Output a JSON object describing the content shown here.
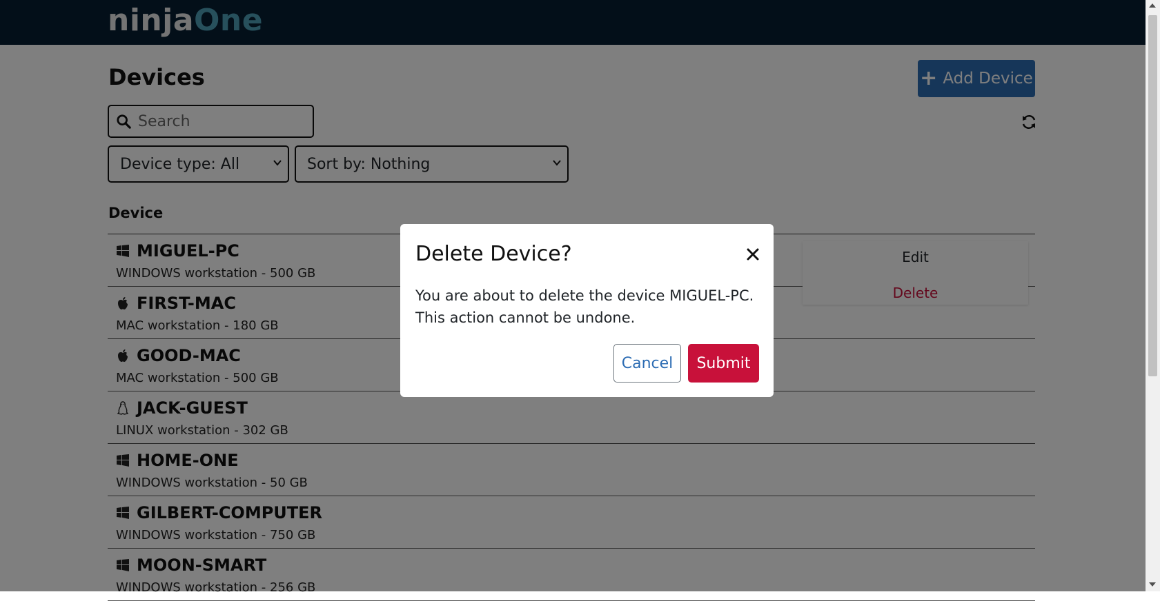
{
  "brand": {
    "logo_part1": "ninja",
    "logo_part2": "One"
  },
  "header": {
    "title": "Devices",
    "add_button_label": "Add Device"
  },
  "search": {
    "placeholder": "Search"
  },
  "filters": {
    "device_type": "Device type: All",
    "sort_by": "Sort by: Nothing"
  },
  "table": {
    "column_header": "Device"
  },
  "devices": [
    {
      "name": "MIGUEL-PC",
      "detail": "WINDOWS workstation - 500 GB",
      "os": "windows-icon"
    },
    {
      "name": "FIRST-MAC",
      "detail": "MAC workstation - 180 GB",
      "os": "apple-icon"
    },
    {
      "name": "GOOD-MAC",
      "detail": "MAC workstation - 500 GB",
      "os": "apple-icon"
    },
    {
      "name": "JACK-GUEST",
      "detail": "LINUX workstation - 302 GB",
      "os": "linux-icon"
    },
    {
      "name": "HOME-ONE",
      "detail": "WINDOWS workstation - 50 GB",
      "os": "windows-icon"
    },
    {
      "name": "GILBERT-COMPUTER",
      "detail": "WINDOWS workstation - 750 GB",
      "os": "windows-icon"
    },
    {
      "name": "MOON-SMART",
      "detail": "WINDOWS workstation - 256 GB",
      "os": "windows-icon"
    }
  ],
  "context_menu": {
    "edit": "Edit",
    "delete": "Delete"
  },
  "modal": {
    "title": "Delete Device?",
    "body": "You are about to delete the device MIGUEL-PC. This action cannot be undone.",
    "cancel_label": "Cancel",
    "submit_label": "Submit"
  },
  "colors": {
    "topbar": "#061e33",
    "primary": "#2c6cb3",
    "danger": "#c8113a"
  }
}
